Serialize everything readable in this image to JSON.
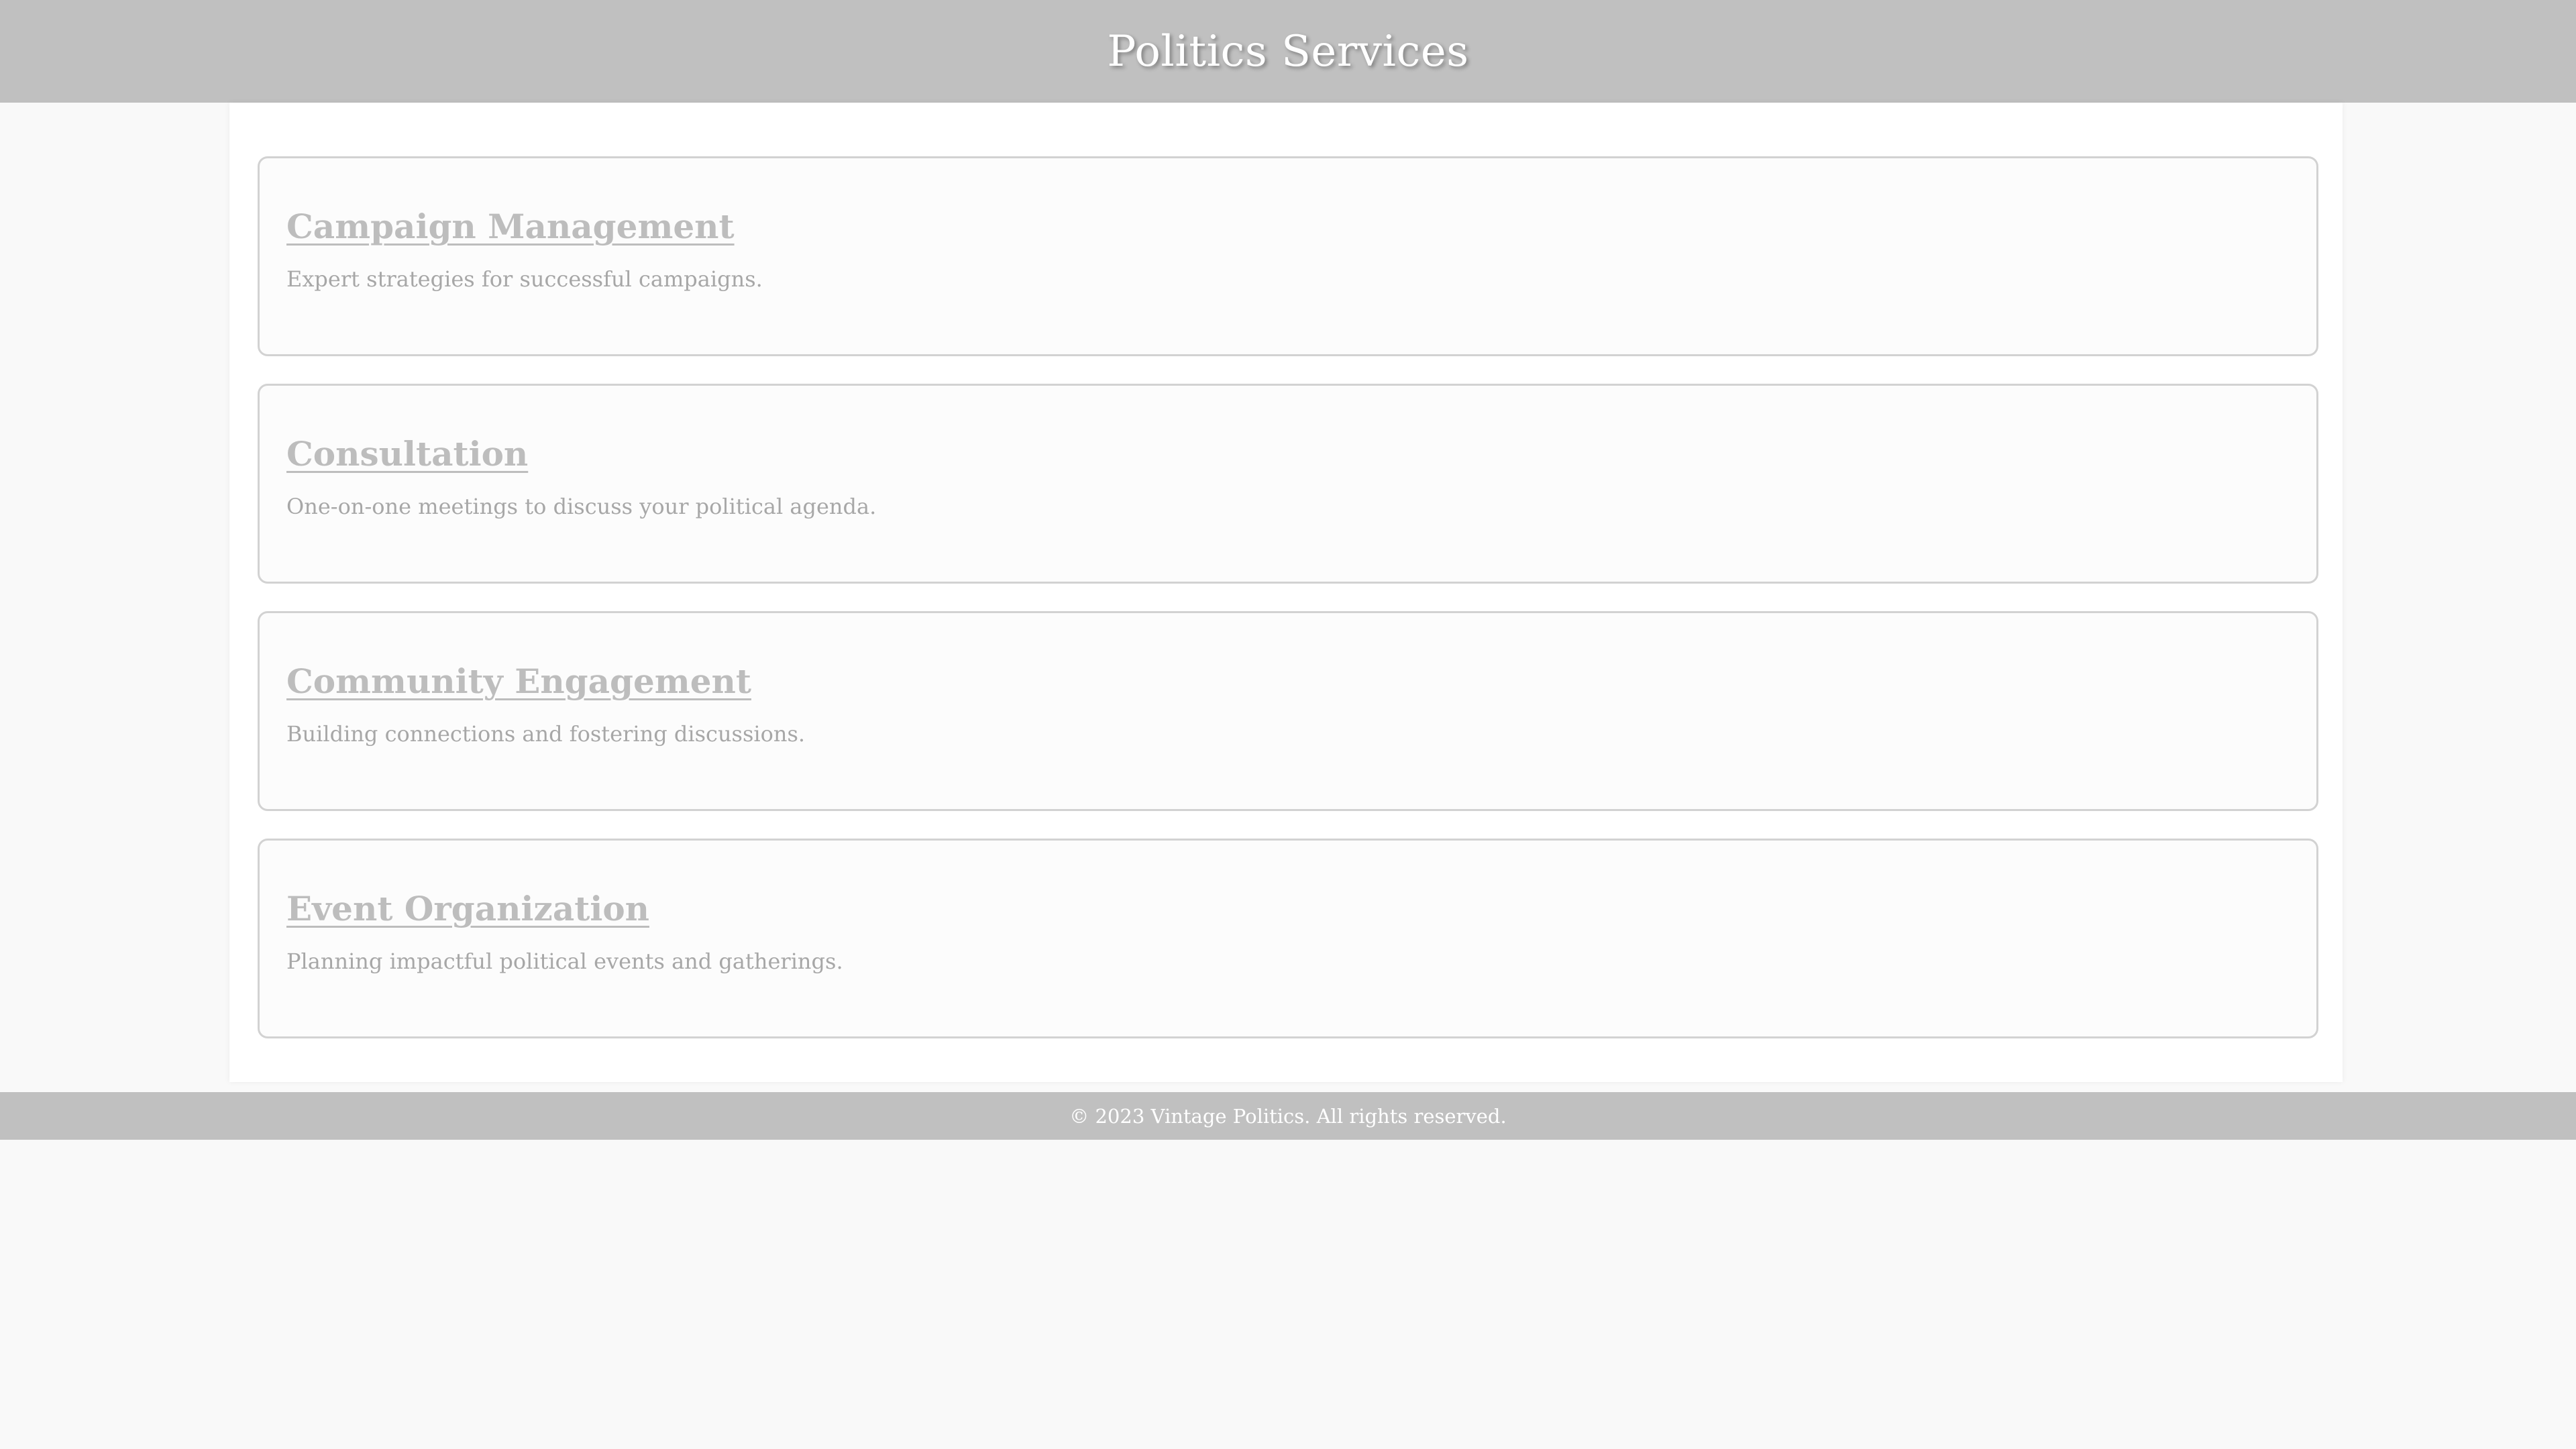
{
  "header": {
    "title": "Politics Services"
  },
  "services": [
    {
      "title": "Campaign Management",
      "description": "Expert strategies for successful campaigns."
    },
    {
      "title": "Consultation",
      "description": "One-on-one meetings to discuss your political agenda."
    },
    {
      "title": "Community Engagement",
      "description": "Building connections and fostering discussions."
    },
    {
      "title": "Event Organization",
      "description": "Planning impactful political events and gatherings."
    }
  ],
  "footer": {
    "text": "© 2023 Vintage Politics. All rights reserved."
  },
  "colors": {
    "header_bg": "#c0c0c0",
    "page_bg": "#f9f9f9",
    "card_bg": "#fcfcfc",
    "card_border": "#d2d2d2",
    "title_text": "#bdbdbd",
    "desc_text": "#a7a7a7"
  }
}
